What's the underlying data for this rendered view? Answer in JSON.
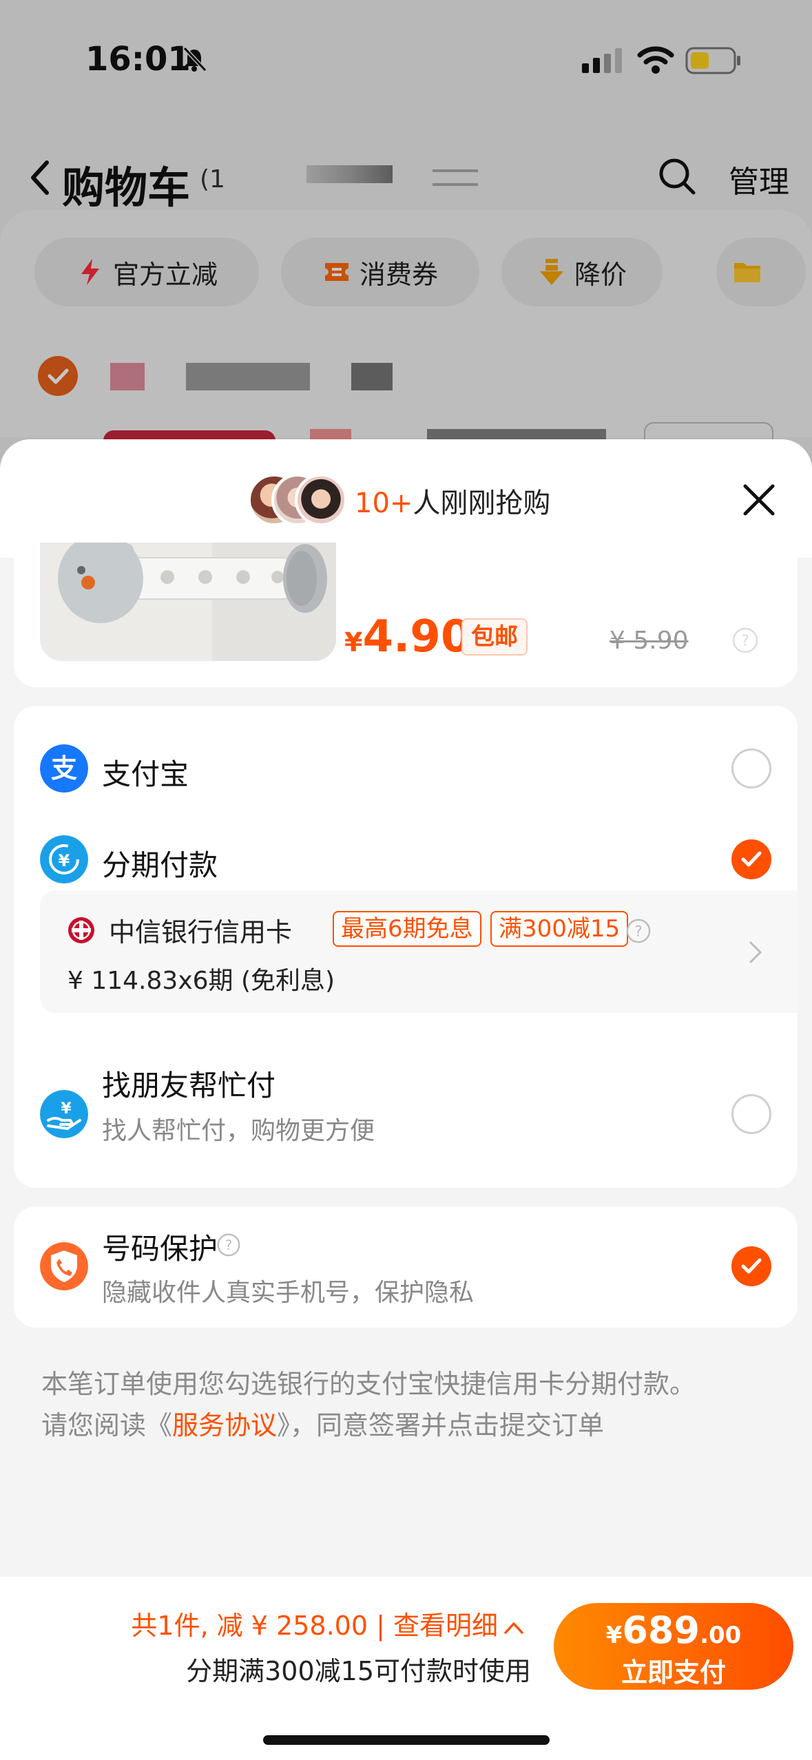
{
  "status_bar": {
    "time": "16:01"
  },
  "nav": {
    "title": "购物车",
    "count": "(1",
    "manage": "管理"
  },
  "filters": [
    {
      "label": "官方立减",
      "icon": "lightning-icon"
    },
    {
      "label": "消费券",
      "icon": "coupon-icon"
    },
    {
      "label": "降价",
      "icon": "price-down-icon"
    },
    {
      "label": "",
      "icon": "folder-icon"
    }
  ],
  "sheet": {
    "header": {
      "count": "10+",
      "text": "人刚刚抢购"
    },
    "product": {
      "currency": "¥",
      "price": "4.90",
      "free_shipping": "包邮",
      "original_price": "¥ 5.90"
    },
    "payment": {
      "alipay": {
        "label": "支付宝",
        "selected": false
      },
      "installment": {
        "label": "分期付款",
        "selected": true,
        "bank": "中信银行信用卡",
        "tag1": "最高6期免息",
        "tag2": "满300减15",
        "amount": "¥ 114.83x6期 (免利息)"
      },
      "friend_pay": {
        "label": "找朋友帮忙付",
        "sub": "找人帮忙付，购物更方便",
        "selected": false
      }
    },
    "protection": {
      "label": "号码保护",
      "sub": "隐藏收件人真实手机号，保护隐私",
      "selected": true
    },
    "notice": {
      "line1": "本笔订单使用您勾选银行的支付宝快捷信用卡分期付款。",
      "line2_prefix": "请您阅读《",
      "link": "服务协议",
      "line2_suffix": "》，同意签署并点击提交订单"
    }
  },
  "bottom": {
    "summary": "共1件, 减 ¥ 258.00 | 查看明细",
    "sub": "分期满300减15可付款时使用",
    "pay_currency": "¥",
    "pay_integer": "689",
    "pay_decimal": ".00",
    "pay_label": "立即支付"
  },
  "colors": {
    "accent": "#ff5000",
    "alipay_blue": "#1677ff",
    "background": "#f4f4f4"
  }
}
